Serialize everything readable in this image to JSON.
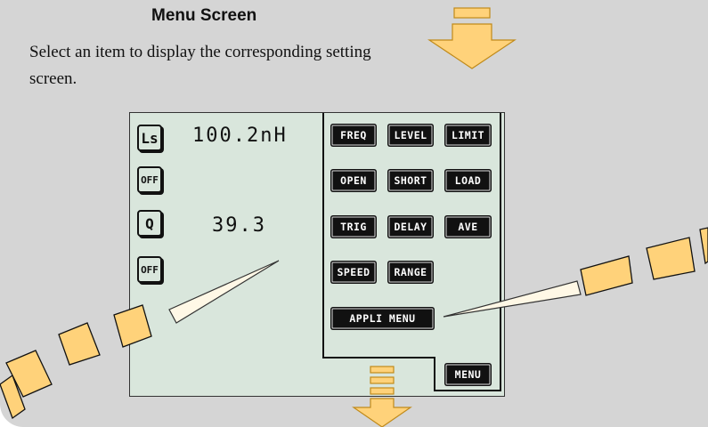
{
  "heading": "Menu Screen",
  "description": "Select an item to display the corresponding setting screen.",
  "colors": {
    "panel": "#d5d5d5",
    "lcd": "#d9e6dc",
    "arrow": "#ffd27a",
    "arrow_outline": "#c08a1a"
  },
  "display": {
    "param1": {
      "label": "Ls",
      "value": "100.2nH",
      "toggle": "OFF"
    },
    "param2": {
      "label": "Q",
      "value": "39.3",
      "toggle": "OFF"
    }
  },
  "menu": {
    "freq": "FREQ",
    "level": "LEVEL",
    "limit": "LIMIT",
    "open": "OPEN",
    "short": "SHORT",
    "load": "LOAD",
    "trig": "TRIG",
    "delay": "DELAY",
    "ave": "AVE",
    "speed": "SPEED",
    "range": "RANGE",
    "appli_menu": "APPLI MENU",
    "menu": "MENU"
  }
}
